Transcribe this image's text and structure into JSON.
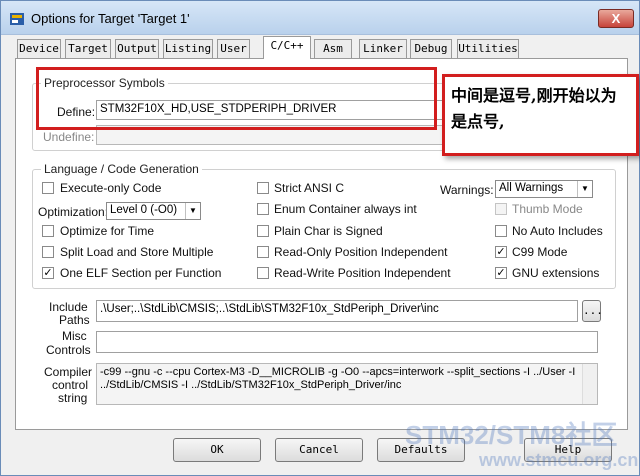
{
  "window": {
    "title": "Options for Target 'Target 1'",
    "close_label": "X"
  },
  "tabs": [
    "Device",
    "Target",
    "Output",
    "Listing",
    "User",
    "C/C++",
    "Asm",
    "Linker",
    "Debug",
    "Utilities"
  ],
  "preprocessor": {
    "group_label": "Preprocessor Symbols",
    "define_label": "Define:",
    "define_value": "STM32F10X_HD,USE_STDPERIPH_DRIVER",
    "undefine_label": "Undefine:"
  },
  "annotation": {
    "text": "中间是逗号,刚开始以为是点号,"
  },
  "language": {
    "group_label": "Language / Code Generation",
    "execute_only": "Execute-only Code",
    "optimization_label": "Optimization:",
    "optimization_value": "Level 0 (-O0)",
    "optimize_time": "Optimize for Time",
    "split_load": "Split Load and Store Multiple",
    "one_elf": "One ELF Section per Function",
    "strict_ansi": "Strict ANSI C",
    "enum_container": "Enum Container always int",
    "plain_char": "Plain Char is Signed",
    "ro_pi": "Read-Only Position Independent",
    "rw_pi": "Read-Write Position Independent",
    "warnings_label": "Warnings:",
    "warnings_value": "All Warnings",
    "thumb_mode": "Thumb Mode",
    "no_auto_includes": "No Auto Includes",
    "c99_mode": "C99 Mode",
    "gnu_ext": "GNU extensions",
    "checked": {
      "one_elf": true,
      "c99_mode": true,
      "gnu_ext": true
    }
  },
  "include": {
    "label_1": "Include",
    "label_2": "Paths",
    "value": ".\\User;..\\StdLib\\CMSIS;..\\StdLib\\STM32F10x_StdPeriph_Driver\\inc",
    "browse": "..."
  },
  "misc": {
    "label_1": "Misc",
    "label_2": "Controls",
    "value": ""
  },
  "compiler": {
    "label_1": "Compiler",
    "label_2": "control",
    "label_3": "string",
    "line1": "-c99 --gnu -c --cpu Cortex-M3 -D__MICROLIB -g -O0 --apcs=interwork --split_sections -I ../User -I",
    "line2": "../StdLib/CMSIS -I ../StdLib/STM32F10x_StdPeriph_Driver/inc"
  },
  "buttons": {
    "ok": "OK",
    "cancel": "Cancel",
    "defaults": "Defaults",
    "help": "Help"
  },
  "watermark": {
    "line1": "STM32/STM8社区",
    "line2": "www.stmcu.org.cn"
  }
}
